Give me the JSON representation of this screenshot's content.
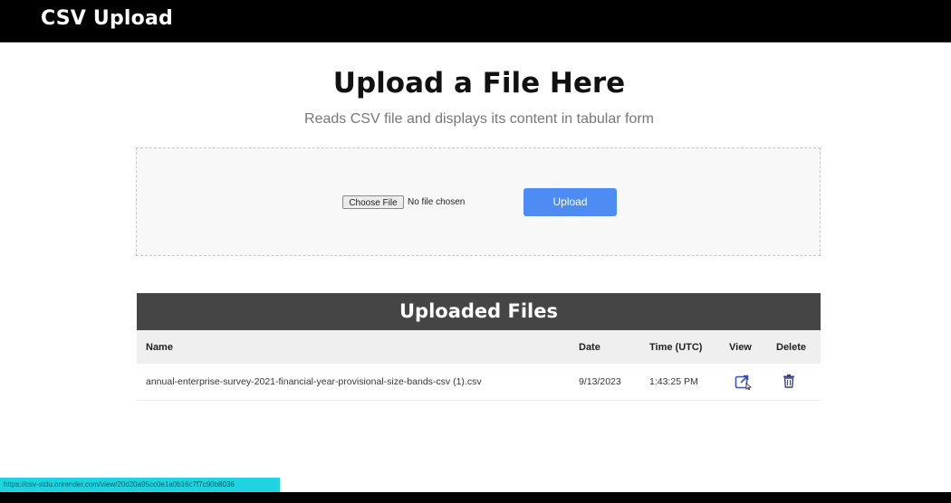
{
  "app": {
    "title": "CSV Upload"
  },
  "main": {
    "title": "Upload a File Here",
    "subtitle": "Reads CSV file and displays its content in tabular form"
  },
  "upload": {
    "choose_label": "Choose File",
    "file_status": "No file chosen",
    "upload_label": "Upload"
  },
  "files": {
    "title": "Uploaded Files",
    "columns": {
      "name": "Name",
      "date": "Date",
      "time": "Time (UTC)",
      "view": "View",
      "delete": "Delete"
    },
    "rows": [
      {
        "name": "annual-enterprise-survey-2021-financial-year-provisional-size-bands-csv (1).csv",
        "date": "9/13/2023",
        "time": "1:43:25 PM",
        "view_icon": "external-link-icon",
        "delete_icon": "trash-icon"
      }
    ]
  },
  "status_url": "https://csv-stdu.onrender.com/view/20d20a95cc0e1a0b16c7f7c90b8036",
  "colors": {
    "topbar": "#000000",
    "accent": "#4d8df3",
    "table_header": "#454545",
    "view_icon": "#3d4fb8",
    "delete_icon": "#3a3f7a"
  }
}
